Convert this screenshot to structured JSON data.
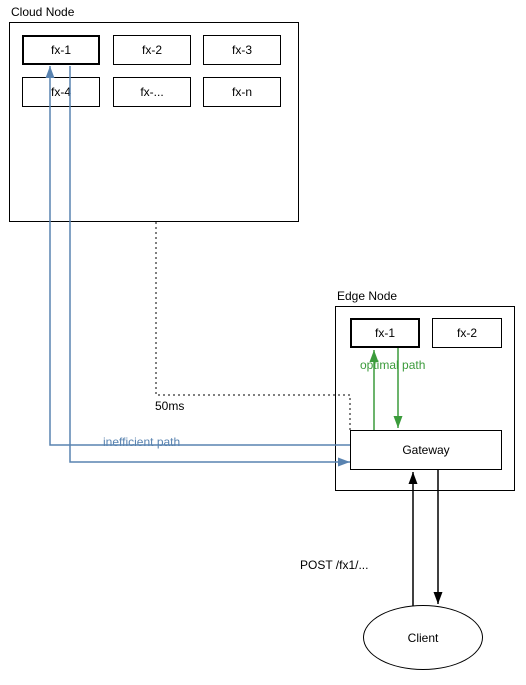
{
  "cloud": {
    "title": "Cloud Node",
    "functions": [
      "fx-1",
      "fx-2",
      "fx-3",
      "fx-4",
      "fx-...",
      "fx-n"
    ]
  },
  "edge": {
    "title": "Edge Node",
    "functions": [
      "fx-1",
      "fx-2"
    ],
    "gateway": "Gateway"
  },
  "client": {
    "label": "Client",
    "request": "POST /fx1/..."
  },
  "paths": {
    "inefficient": "inefficient path",
    "optimal": "optimal path",
    "latency": "50ms"
  }
}
